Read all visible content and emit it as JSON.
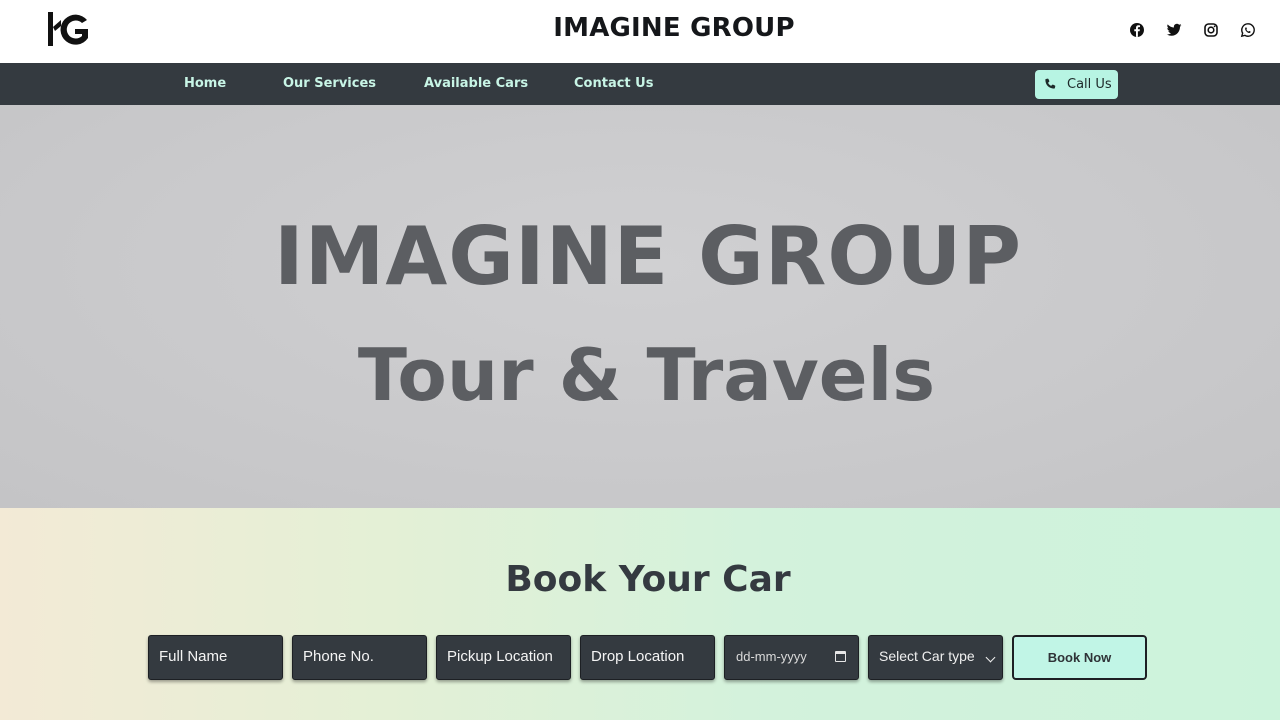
{
  "header": {
    "logo_text": "IG",
    "title": "IMAGINE GROUP",
    "socials": [
      "facebook-icon",
      "twitter-icon",
      "instagram-icon",
      "whatsapp-icon"
    ]
  },
  "nav": {
    "items": [
      {
        "label": "Home"
      },
      {
        "label": "Our Services"
      },
      {
        "label": "Available Cars"
      },
      {
        "label": "Contact Us"
      }
    ],
    "call_label": "Call Us",
    "call_icon": "phone-icon"
  },
  "hero": {
    "line1": "IMAGINE GROUP",
    "line2": "Tour & Travels"
  },
  "booking": {
    "title": "Book Your Car",
    "fields": {
      "name_placeholder": "Full Name",
      "phone_placeholder": "Phone No.",
      "pickup_placeholder": "Pickup Location",
      "drop_placeholder": "Drop Location",
      "date_placeholder": "dd-mm-yyyy",
      "car_type_selected": "Select Car type"
    },
    "submit_label": "Book Now"
  },
  "colors": {
    "nav_bg": "#343a40",
    "nav_text": "#c8f5e6",
    "accent": "#b7f4e3",
    "hero_text": "#5c5e62"
  }
}
